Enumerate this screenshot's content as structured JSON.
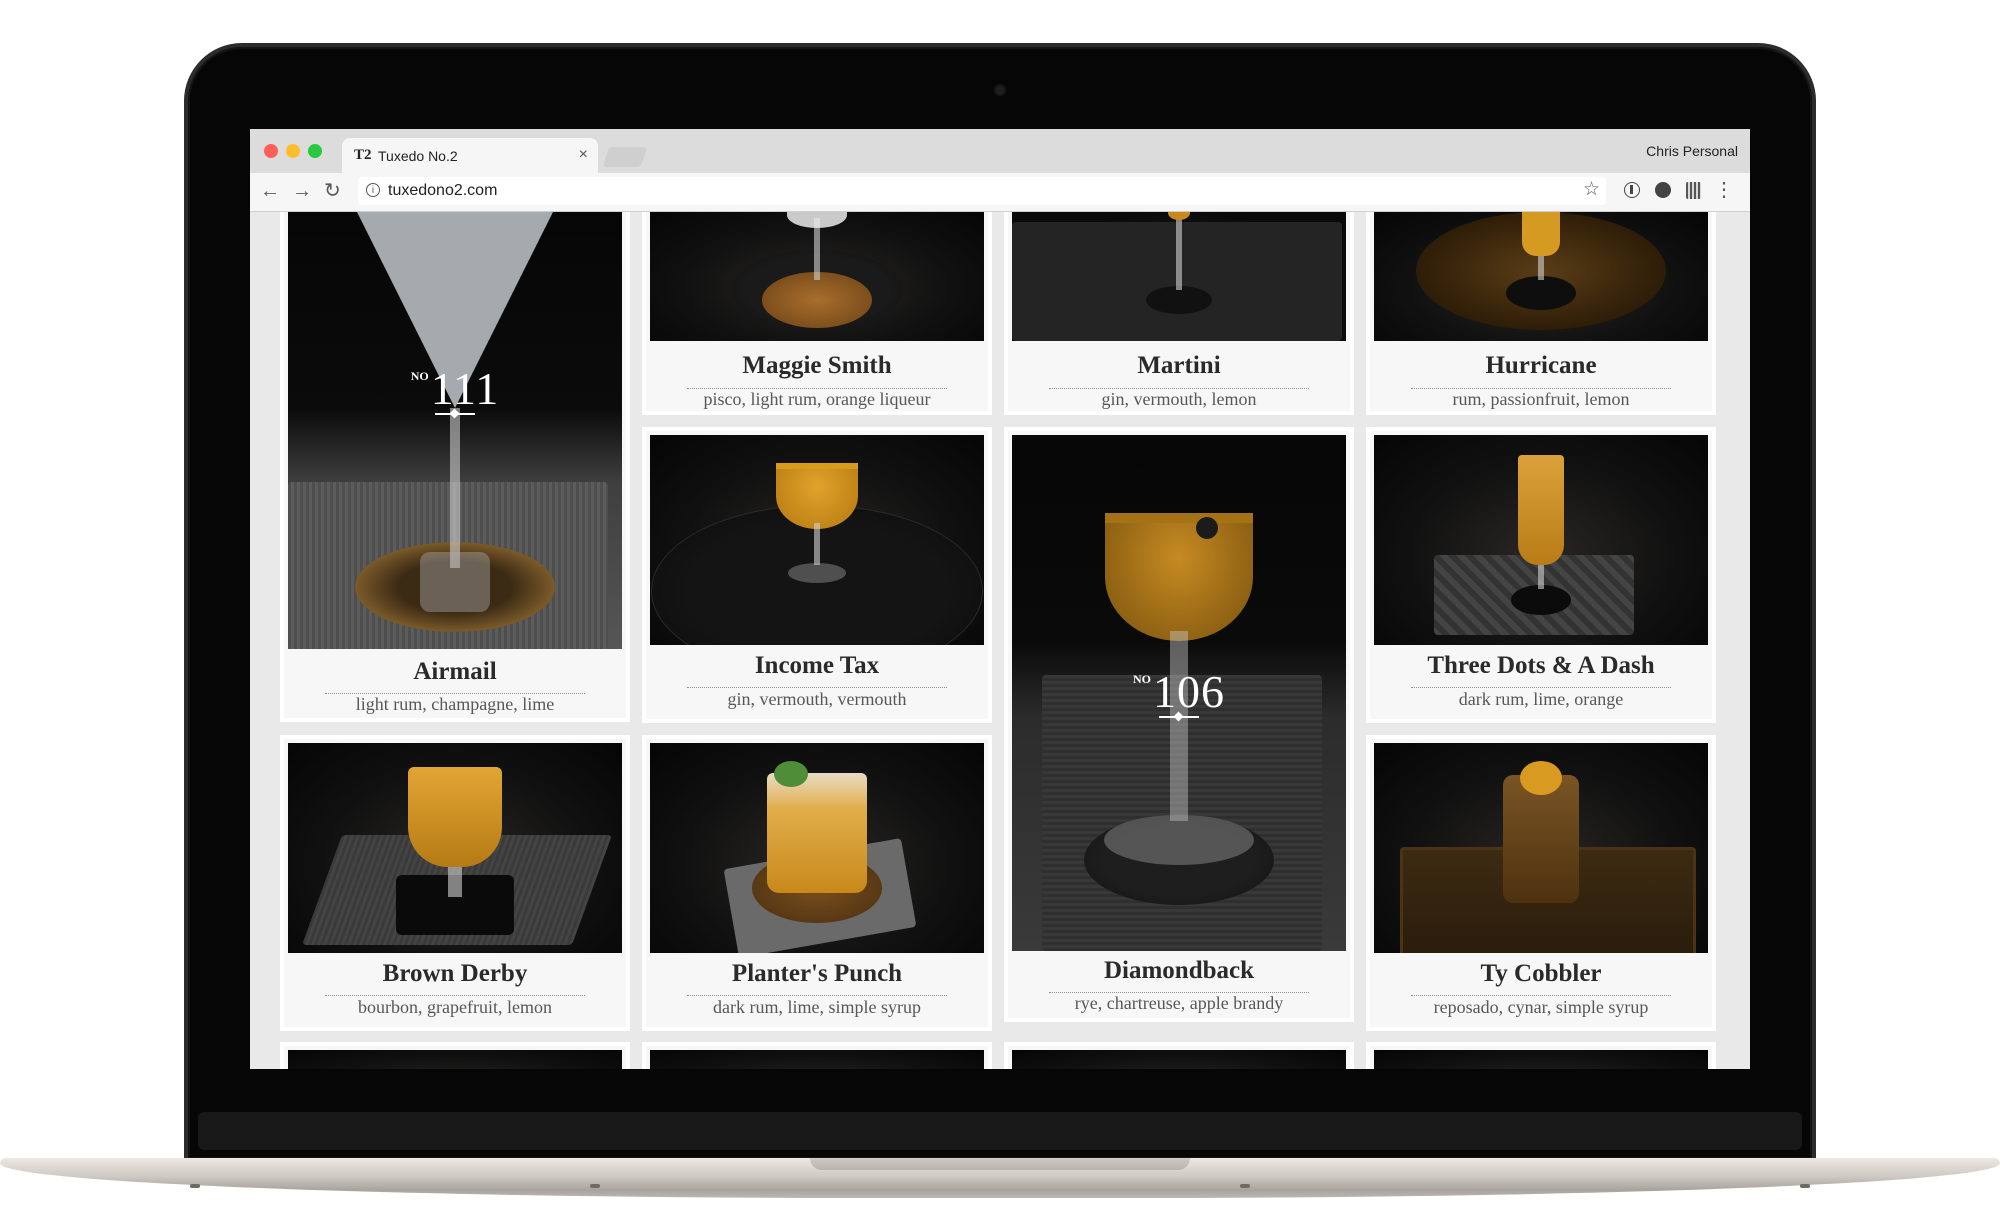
{
  "browser": {
    "tab_title": "Tuxedo No.2",
    "tab_favicon": "T2",
    "tab_close": "×",
    "profile_name": "Chris Personal",
    "url": "tuxedono2.com",
    "icons": {
      "back": "back-arrow-icon",
      "forward": "forward-arrow-icon",
      "reload": "reload-icon",
      "info": "info-icon",
      "star": "bookmark-star-icon",
      "menu": "kebab-menu-icon"
    },
    "glyphs": {
      "back": "←",
      "forward": "→",
      "reload": "↻",
      "info": "i",
      "star": "☆",
      "menu": "⋮"
    }
  },
  "cocktails": [
    {
      "name": "Maggie Smith",
      "ingredients": "pisco, light rum, orange liqueur"
    },
    {
      "name": "Martini",
      "ingredients": "gin, vermouth, lemon"
    },
    {
      "name": "Hurricane",
      "ingredients": "rum, passionfruit, lemon"
    },
    {
      "name": "Airmail",
      "ingredients": "light rum, champagne, lime",
      "badge_no": "NO",
      "badge_number": "111"
    },
    {
      "name": "Income Tax",
      "ingredients": "gin, vermouth, vermouth"
    },
    {
      "name": "Three Dots & A Dash",
      "ingredients": "dark rum, lime, orange"
    },
    {
      "name": "Diamondback",
      "ingredients": "rye, chartreuse, apple brandy",
      "badge_no": "NO",
      "badge_number": "106"
    },
    {
      "name": "Brown Derby",
      "ingredients": "bourbon, grapefruit, lemon"
    },
    {
      "name": "Planter's Punch",
      "ingredients": "dark rum, lime, simple syrup"
    },
    {
      "name": "Ty Cobbler",
      "ingredients": "reposado, cynar, simple syrup"
    }
  ],
  "colors": {
    "page_background": "#e9e9e9",
    "card_background": "#f7f7f7",
    "drink_amber": "#c98a1c",
    "close_button": "#ff5f57",
    "minimize_button": "#ffbd2e",
    "zoom_button": "#28c940"
  }
}
